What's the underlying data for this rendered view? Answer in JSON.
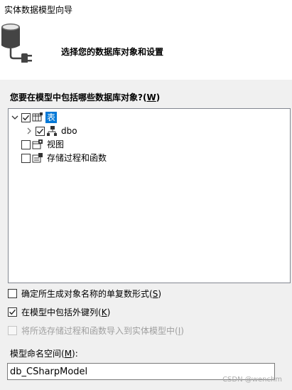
{
  "window": {
    "title": "实体数据模型向导"
  },
  "header": {
    "subtitle": "选择您的数据库对象和设置",
    "icon": "database-plug-icon"
  },
  "tree_section": {
    "label_prefix": "您要在模型中包括哪些数据库对象?(",
    "label_key": "W",
    "label_suffix": ")",
    "nodes": [
      {
        "label": "表",
        "checked": true,
        "expanded": true,
        "selected": true,
        "icon": "table-icon"
      },
      {
        "label": "dbo",
        "checked": true,
        "expanded": false,
        "selected": false,
        "icon": "schema-icon"
      },
      {
        "label": "视图",
        "checked": false,
        "selected": false,
        "icon": "view-icon"
      },
      {
        "label": "存储过程和函数",
        "checked": false,
        "selected": false,
        "icon": "stored-procedure-icon"
      }
    ]
  },
  "options": [
    {
      "prefix": "确定所生成对象名称的单复数形式(",
      "key": "S",
      "suffix": ")",
      "checked": false,
      "enabled": true
    },
    {
      "prefix": "在模型中包括外键列(",
      "key": "K",
      "suffix": ")",
      "checked": true,
      "enabled": true
    },
    {
      "prefix": "将所选存储过程和函数导入到实体模型中(",
      "key": "I",
      "suffix": ")",
      "checked": false,
      "enabled": false
    }
  ],
  "namespace": {
    "label_prefix": "模型命名空间(",
    "label_key": "M",
    "label_suffix": "):",
    "value": "db_CSharpModel"
  },
  "watermark": "CSDN @wenchm",
  "colors": {
    "selection": "#0078d7",
    "header_bg": "#ffffff",
    "body_bg": "#f0f0f0",
    "disabled_text": "#a0a0a0"
  }
}
